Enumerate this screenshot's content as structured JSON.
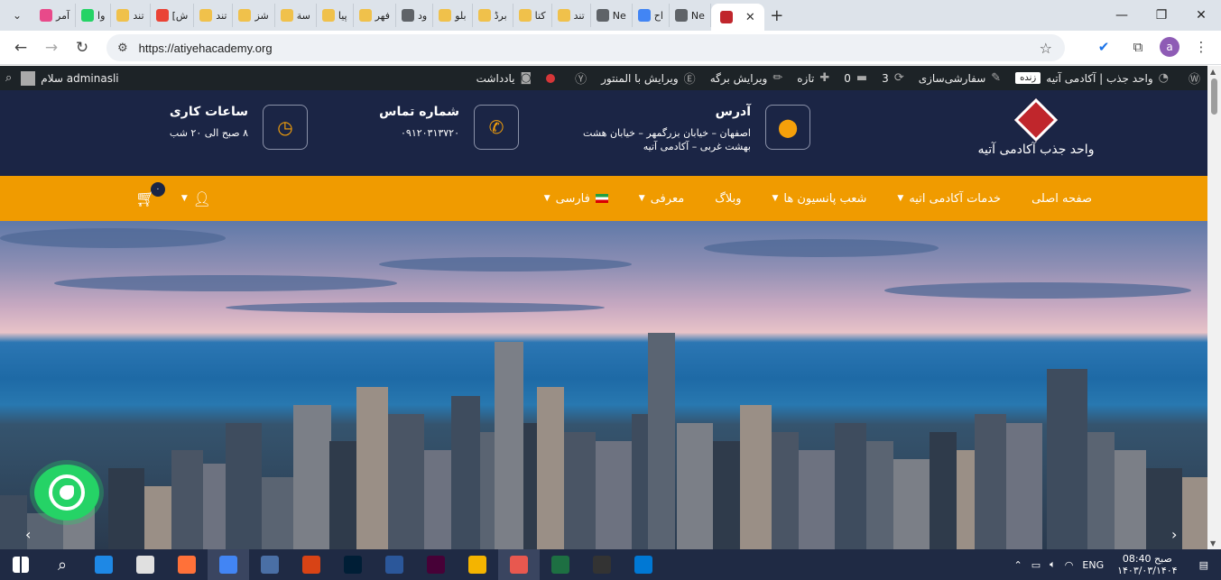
{
  "browser": {
    "tabs": [
      {
        "label": "آمر",
        "color": "#e84a8a"
      },
      {
        "label": "وا",
        "color": "#25d366"
      },
      {
        "label": "تند",
        "color": "#f0c14b"
      },
      {
        "label": "[ش",
        "color": "#ea4335"
      },
      {
        "label": "تند",
        "color": "#f0c14b"
      },
      {
        "label": "شز",
        "color": "#f0c14b"
      },
      {
        "label": "سة",
        "color": "#f0c14b"
      },
      {
        "label": "پیا",
        "color": "#f0c14b"
      },
      {
        "label": "فهر",
        "color": "#f0c14b"
      },
      {
        "label": "ود",
        "color": "#5f6368"
      },
      {
        "label": "بلو",
        "color": "#f0c14b"
      },
      {
        "label": "برڈ",
        "color": "#f0c14b"
      },
      {
        "label": "کتا",
        "color": "#f0c14b"
      },
      {
        "label": "تند",
        "color": "#f0c14b"
      },
      {
        "label": "Ne",
        "color": "#5f6368"
      },
      {
        "label": "اح",
        "color": "#4285f4"
      },
      {
        "label": "Ne",
        "color": "#5f6368"
      }
    ],
    "active_tab_color": "#c0262c",
    "url": "https://atiyehacademy.org"
  },
  "adminbar": {
    "site_name": "واحد جذب | آکادمی آتیه",
    "live": "زنده",
    "customize": "سفارشی‌سازی",
    "updates": "3",
    "comments": "0",
    "new": "تازه",
    "edit_page": "ویرایش برگه",
    "edit_elementor": "ویرایش با المنتور",
    "notes": "یادداشت",
    "greeting": "سلام adminasli"
  },
  "header": {
    "brand_name": "واحد جذب آکادمی آتیه",
    "address_title": "آدرس",
    "address_line1": "اصفهان – خیابان بزرگمهر – خیابان هشت",
    "address_line2": "بهشت غربی – آکادمی آتیه",
    "phone_title": "شماره تماس",
    "phone_value": "۰۹۱۲۰۳۱۳۷۲۰",
    "hours_title": "ساعات کاری",
    "hours_value": "۸ صبح الی ۲۰ شب"
  },
  "nav": {
    "items": [
      "صفحه اصلی",
      "خدمات آکادمی اتیه",
      "شعب پانسیون ها",
      "وبلاگ",
      "معرفی",
      "فارسی"
    ],
    "cart_count": "۰"
  },
  "taskbar": {
    "lang": "ENG",
    "time": "صبح 08:40",
    "date": "۱۴۰۳/۰۳/۱۴۰۴",
    "app_colors": [
      "#1e88e5",
      "#e0e0e0",
      "#ff7139",
      "#4285f4",
      "#4a6fa5",
      "#d84315",
      "#001e36",
      "#2b579a",
      "#470137",
      "#f4b400",
      "#e8584f",
      "#1d6f42",
      "#333333",
      "#0078d4"
    ]
  }
}
